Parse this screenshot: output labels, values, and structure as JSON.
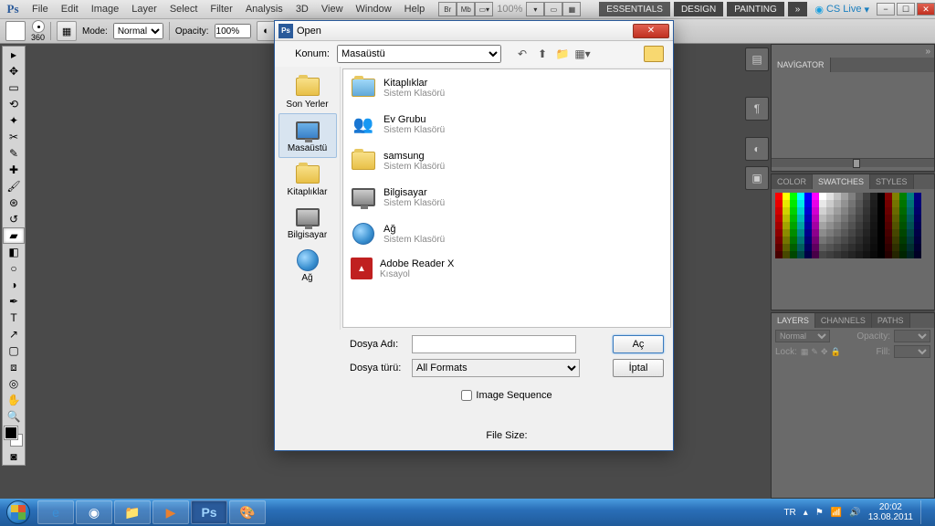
{
  "menubar": {
    "logo": "Ps",
    "items": [
      "File",
      "Edit",
      "Image",
      "Layer",
      "Select",
      "Filter",
      "Analysis",
      "3D",
      "View",
      "Window",
      "Help"
    ],
    "tray_icons": [
      "Br",
      "Mb"
    ],
    "zoom": "100%",
    "workspaces": [
      "ESSENTIALS",
      "DESIGN",
      "PAINTING"
    ],
    "more": "»",
    "cslive": "CS Live"
  },
  "optionsbar": {
    "brush_size": "360",
    "mode_label": "Mode:",
    "mode_value": "Normal",
    "opacity_label": "Opacity:",
    "opacity_value": "100%"
  },
  "toolbox": {
    "tools": [
      "move",
      "marquee",
      "lasso",
      "wand",
      "crop",
      "eyedropper",
      "healing",
      "brush",
      "stamp",
      "history",
      "eraser",
      "gradient",
      "blur",
      "dodge",
      "pen",
      "type",
      "path",
      "rect",
      "hand",
      "notes",
      "zoom",
      "rotate"
    ],
    "active_index": 10
  },
  "dialog": {
    "title": "Open",
    "location_label": "Konum:",
    "location_value": "Masaüstü",
    "places": [
      {
        "label": "Son Yerler",
        "icon": "recent"
      },
      {
        "label": "Masaüstü",
        "icon": "desktop",
        "selected": true
      },
      {
        "label": "Kitaplıklar",
        "icon": "libraries"
      },
      {
        "label": "Bilgisayar",
        "icon": "computer"
      },
      {
        "label": "Ağ",
        "icon": "network"
      }
    ],
    "files": [
      {
        "name": "Kitaplıklar",
        "sub": "Sistem Klasörü",
        "icon": "libraries"
      },
      {
        "name": "Ev Grubu",
        "sub": "Sistem Klasörü",
        "icon": "homegroup"
      },
      {
        "name": "samsung",
        "sub": "Sistem Klasörü",
        "icon": "user"
      },
      {
        "name": "Bilgisayar",
        "sub": "Sistem Klasörü",
        "icon": "computer"
      },
      {
        "name": "Ağ",
        "sub": "Sistem Klasörü",
        "icon": "network"
      },
      {
        "name": "Adobe Reader X",
        "sub": "Kısayol",
        "icon": "pdf"
      }
    ],
    "filename_label": "Dosya Adı:",
    "filename_value": "",
    "filetype_label": "Dosya türü:",
    "filetype_value": "All Formats",
    "open_btn": "Aç",
    "cancel_btn": "İptal",
    "image_sequence": "Image Sequence",
    "filesize_label": "File Size:"
  },
  "panels": {
    "navigator": {
      "tab": "NAVİGATOR"
    },
    "color": {
      "tabs": [
        "COLOR",
        "SWATCHES",
        "STYLES"
      ],
      "active": 1
    },
    "layers": {
      "tabs": [
        "LAYERS",
        "CHANNELS",
        "PATHS"
      ],
      "active": 0,
      "blend_mode": "Normal",
      "opacity_label": "Opacity:",
      "lock_label": "Lock:",
      "fill_label": "Fill:"
    }
  },
  "taskbar": {
    "lang": "TR",
    "time": "20:02",
    "date": "13.08.2011"
  }
}
